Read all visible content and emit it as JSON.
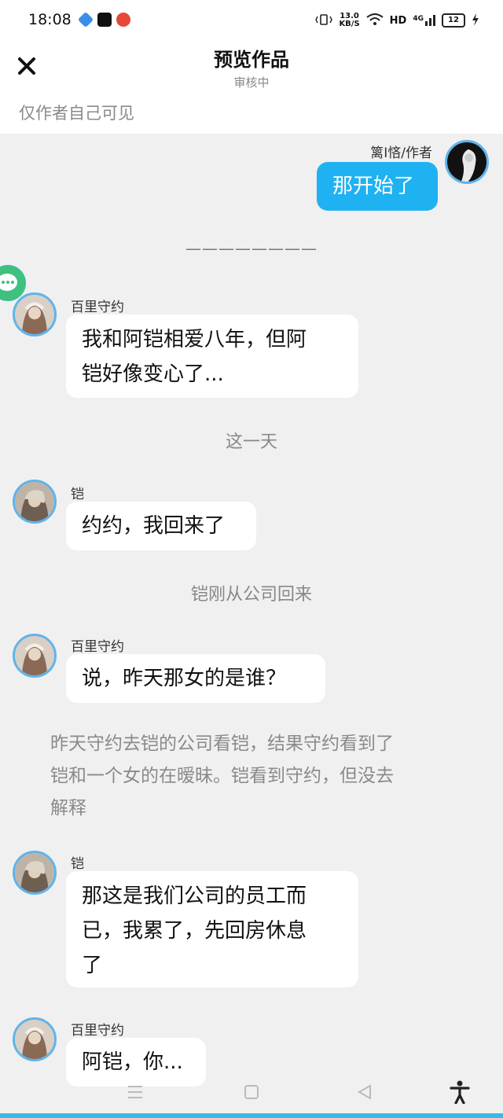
{
  "status_bar": {
    "time": "18:08",
    "speed": "13.0",
    "speed_unit": "KB/S",
    "network": "HD",
    "signal": "4G",
    "battery": "12"
  },
  "header": {
    "title": "预览作品",
    "subtitle": "审核中",
    "visibility": "仅作者自己可见"
  },
  "messages": {
    "m1": {
      "name": "篱I悋/作者",
      "text": "那开始了"
    },
    "divider": "————————",
    "m2": {
      "name": "百里守约",
      "line1": "我和阿铠相爱八年，但阿",
      "line2": "铠好像变心了..."
    },
    "narr1": "这一天",
    "m3": {
      "name": "铠",
      "text": "约约，我回来了"
    },
    "narr2": "铠刚从公司回来",
    "m4": {
      "name": "百里守约",
      "text": "说，昨天那女的是谁？"
    },
    "narr3": {
      "line1": "昨天守约去铠的公司看铠，结果守约看到了",
      "line2": "铠和一个女的在暧昧。铠看到守约，但没去",
      "line3": "解释"
    },
    "m5": {
      "name": "铠",
      "line1": "那这是我们公司的员工而",
      "line2": "已，我累了，先回房休息",
      "line3": "了"
    },
    "m6": {
      "name": "百里守约",
      "text": "阿铠，你..."
    }
  },
  "colors": {
    "accent": "#1fb2f3",
    "avatar_ring": "#5fb4ec",
    "background": "#f0f0f0"
  }
}
